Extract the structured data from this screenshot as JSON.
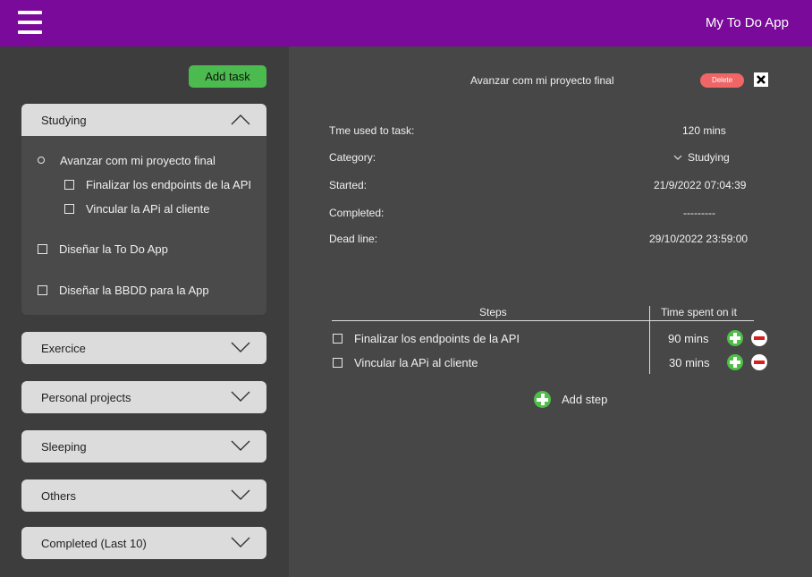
{
  "header": {
    "app_title": "My To Do App"
  },
  "sidebar": {
    "add_task_label": "Add task",
    "categories": [
      {
        "label": "Studying",
        "expanded": true
      },
      {
        "label": "Exercice",
        "expanded": false
      },
      {
        "label": "Personal projects",
        "expanded": false
      },
      {
        "label": "Sleeping",
        "expanded": false
      },
      {
        "label": "Others",
        "expanded": false
      },
      {
        "label": "Completed (Last 10)",
        "expanded": false
      }
    ],
    "studying_tasks": [
      {
        "label": "Avanzar com mi proyecto final",
        "selected": true
      },
      {
        "label": "Finalizar los endpoints de la API",
        "subtask": true
      },
      {
        "label": "Vincular la APi al cliente",
        "subtask": true
      },
      {
        "label": "Diseñar la To Do App"
      },
      {
        "label": "Diseñar la BBDD para la App"
      }
    ]
  },
  "detail": {
    "title": "Avanzar com mi proyecto final",
    "delete_label": "Delete",
    "fields": [
      {
        "label": "Tme used to task:",
        "value": "120 mins"
      },
      {
        "label": "Category:",
        "value": "Studying"
      },
      {
        "label": "Started:",
        "value": "21/9/2022 07:04:39"
      },
      {
        "label": "Completed:",
        "value": "---------"
      },
      {
        "label": "Dead line:",
        "value": "29/10/2022 23:59:00"
      }
    ],
    "steps_header": "Steps",
    "time_header": "Time spent on it",
    "steps": [
      {
        "label": "Finalizar los endpoints de la API",
        "time": "90 mins"
      },
      {
        "label": "Vincular la APi al cliente",
        "time": "30 mins"
      }
    ],
    "add_step_label": "Add step"
  },
  "colors": {
    "topbar": "#7a0a9a",
    "sidebar_bg": "#3d3d3d",
    "main_bg": "#474747",
    "add_green": "#4cbb4f",
    "delete_red": "#f06666"
  }
}
